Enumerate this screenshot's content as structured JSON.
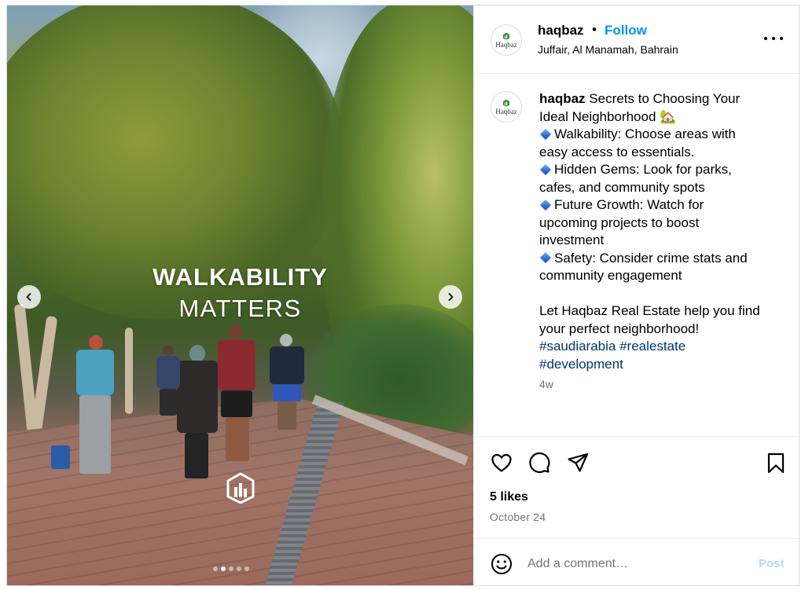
{
  "media": {
    "headline_1": "WALKABILITY",
    "headline_2": "MATTERS",
    "slide_count": 5,
    "active_slide": 2,
    "brand_mark": "haqbaz-building-icon"
  },
  "header": {
    "username": "haqbaz",
    "separator": "•",
    "follow_label": "Follow",
    "location": "Juffair, Al Manamah, Bahrain",
    "avatar_text": "Haqbaz",
    "more_icon": "more-horizontal-icon"
  },
  "caption": {
    "username": "haqbaz",
    "line1": "Secrets to Choosing Your",
    "line2": "Ideal Neighborhood 🏡",
    "bullet1_a": "Walkability: Choose areas with",
    "bullet1_b": "easy access to essentials.",
    "bullet2_a": "Hidden Gems: Look for parks,",
    "bullet2_b": "cafes, and community spots",
    "bullet3_a": "Future Growth: Watch for",
    "bullet3_b": "upcoming projects to boost",
    "bullet3_c": "investment",
    "bullet4_a": "Safety: Consider crime stats and",
    "bullet4_b": "community engagement",
    "closing_a": "Let Haqbaz Real Estate help you find",
    "closing_b": "your perfect neighborhood!",
    "hashtags_a": "#saudiarabia #realestate",
    "hashtags_b": "#development",
    "time_ago": "4w"
  },
  "actions": {
    "likes": "5 likes",
    "date": "October 24",
    "icons": [
      "heart-icon",
      "comment-icon",
      "share-icon",
      "bookmark-icon"
    ]
  },
  "composer": {
    "placeholder": "Add a comment…",
    "post_label": "Post"
  },
  "colors": {
    "accent": "#0095f6",
    "post_disabled": "#b3dbff",
    "muted": "#737373",
    "hashtag": "#00376b"
  }
}
